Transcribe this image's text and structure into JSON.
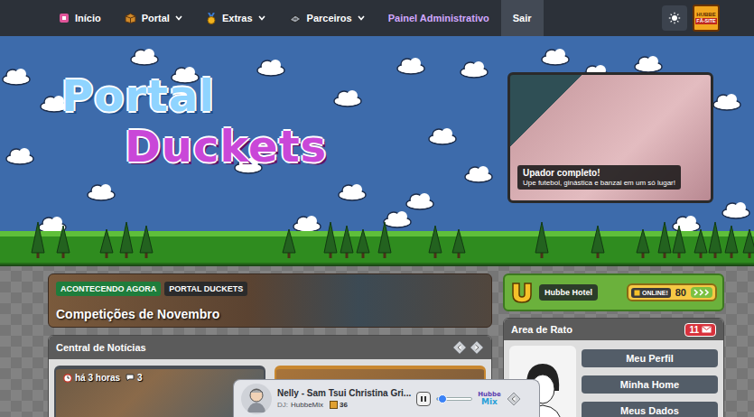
{
  "nav": {
    "items": [
      {
        "label": "Início",
        "kind": "home",
        "dropdown": false,
        "selected": false
      },
      {
        "label": "Portal",
        "kind": "portal",
        "dropdown": true,
        "selected": false
      },
      {
        "label": "Extras",
        "kind": "extras",
        "dropdown": true,
        "selected": false
      },
      {
        "label": "Parceiros",
        "kind": "partners",
        "dropdown": true,
        "selected": false
      },
      {
        "label": "Painel Administrativo",
        "kind": "admin",
        "dropdown": false,
        "selected": false
      },
      {
        "label": "Sair",
        "kind": "plain",
        "dropdown": false,
        "selected": true
      }
    ],
    "badge": {
      "line1": "HUBBE",
      "line2": "FÃ-SITE"
    }
  },
  "hero": {
    "logo": {
      "line1": "Portal",
      "line2": "Duckets"
    },
    "slide": {
      "title": "Upador completo!",
      "subtitle": "Upe futebol, ginástica e banzai em um só lugar!"
    }
  },
  "banner": {
    "tags": [
      {
        "label": "ACONTECENDO AGORA",
        "color": "#1e7d3c"
      },
      {
        "label": "PORTAL DUCKETS",
        "color": "#2b2b2b"
      }
    ],
    "title": "Competições de Novembro"
  },
  "news": {
    "title": "Central de Notícias",
    "cards": [
      {
        "kind": "full",
        "time": "há 3 horas",
        "comments": "3",
        "color": "#4a4f56"
      },
      {
        "kind": "plain",
        "color": "#c8872f"
      }
    ]
  },
  "hotel": {
    "name": "Hubbe Hotel",
    "status": "ONLINE!",
    "count": "80"
  },
  "user_panel": {
    "title": "Area de Rato",
    "messages": "11",
    "buttons": [
      "Meu Perfil",
      "Minha Home",
      "Meus Dados"
    ]
  },
  "player": {
    "title": "Nelly - Sam Tsui Christina Gri...",
    "dj_label": "DJ:",
    "dj": "HubbeMix",
    "listeners": "36",
    "playing": true,
    "level": 0.15,
    "logo": {
      "line1": "Hubbe",
      "line2": "Mix"
    }
  }
}
